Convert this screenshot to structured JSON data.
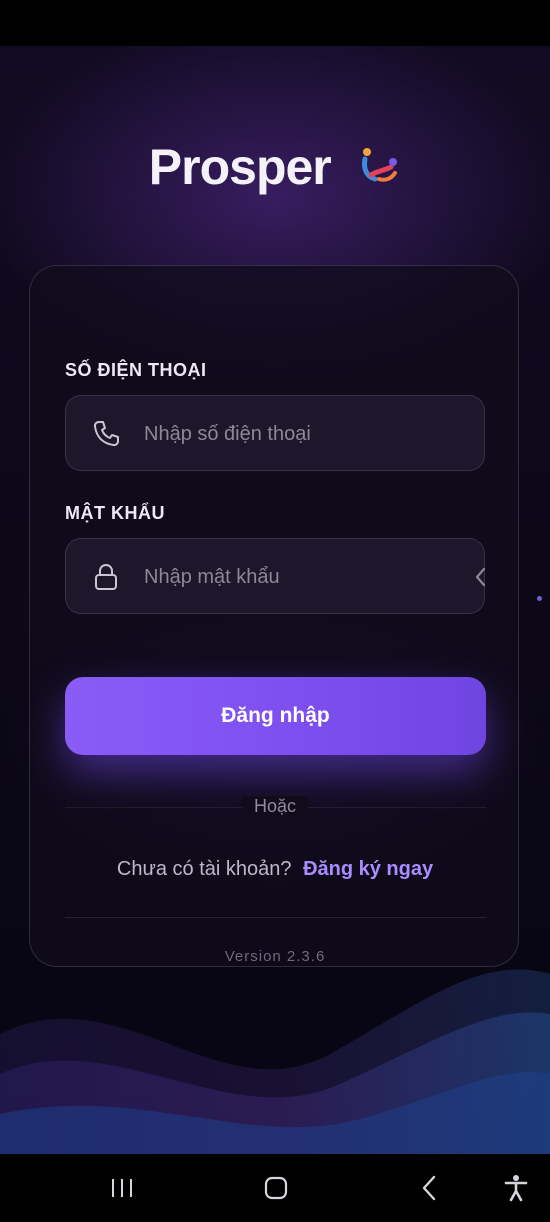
{
  "brand": {
    "name": "Prosper",
    "logo_icon": "colorful-figure-logo-icon"
  },
  "form": {
    "phone_label": "SỐ ĐIỆN THOẠI",
    "phone_placeholder": "Nhập số điện thoại",
    "phone_value": "",
    "phone_icon": "phone-icon",
    "password_label": "MẬT KHẨU",
    "password_placeholder": "Nhập mật khẩu",
    "password_value": "",
    "password_icon": "lock-icon",
    "login_button": "Đăng nhập",
    "or_text": "Hoặc",
    "no_account_text": "Chưa có tài khoản?",
    "register_link": "Đăng ký ngay",
    "version": "Version 2.3.6"
  },
  "navigation_bar": {
    "recents": "recents-icon",
    "home": "home-icon",
    "back": "back-icon",
    "accessibility": "accessibility-icon"
  },
  "colors": {
    "accent": "#8a5cf6",
    "link": "#a98cff",
    "background": "#0d0819"
  }
}
